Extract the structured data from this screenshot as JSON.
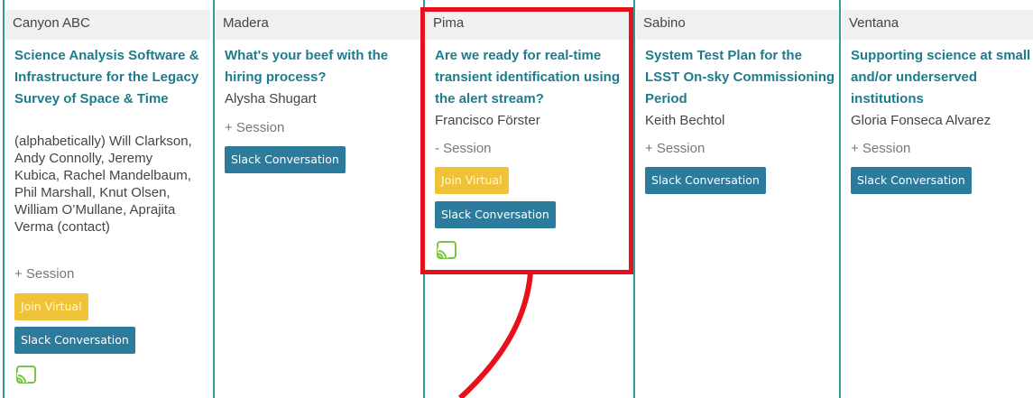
{
  "columns": [
    {
      "room": "Canyon ABC",
      "title": "Science Analysis Software & Infrastructure for the Legacy Survey of Space & Time",
      "presenter": "(alphabetically) Will Clarkson, Andy Connolly, Jeremy Kubica, Rachel Mandelbaum, Phil Marshall, Knut Olsen, William O’Mullane, Aprajita Verma (contact)",
      "session": "+ Session",
      "join_label": "Join Virtual",
      "slack_label": "Slack Conversation",
      "cast_icon": "cast-icon"
    },
    {
      "room": "Madera",
      "title": "What's your beef with the hiring process?",
      "presenter": "Alysha Shugart",
      "session": "+ Session",
      "slack_label": "Slack Conversation"
    },
    {
      "room": "Pima",
      "title": "Are we ready for real-time transient identification using the alert stream?",
      "presenter": "Francisco Förster",
      "session": "- Session",
      "join_label": "Join Virtual",
      "slack_label": "Slack Conversation",
      "cast_icon": "cast-icon"
    },
    {
      "room": "Sabino",
      "title": "System Test Plan for the LSST On-sky Commissioning Period",
      "presenter": "Keith Bechtol",
      "session": "+ Session",
      "slack_label": "Slack Conversation"
    },
    {
      "room": "Ventana",
      "title": "Supporting science at small and/or underserved institutions",
      "presenter": "Gloria Fonseca Alvarez",
      "session": "+ Session",
      "slack_label": "Slack Conversation"
    }
  ],
  "colors": {
    "accent_teal": "#2f9a96",
    "title_color": "#1d7c8c",
    "virtual_button": "#f0c237",
    "slack_button": "#2d7b9c",
    "highlight_red": "#e8101a",
    "cast_green": "#7cc443"
  }
}
